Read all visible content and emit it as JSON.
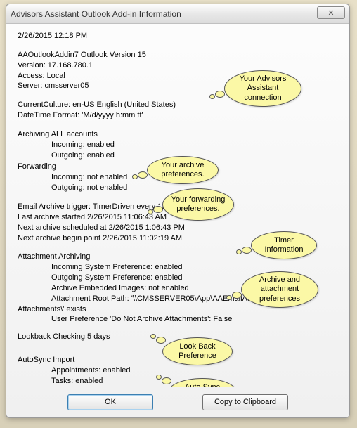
{
  "window": {
    "title": "Advisors Assistant Outlook Add-in Information",
    "close_glyph": "✕"
  },
  "timestamp": "2/26/2015 12:18 PM",
  "connection": {
    "addin_line": "AAOutlookAddin7   Outlook Version 15",
    "version_line": "Version:  17.168.780.1",
    "access_line": "Access:  Local",
    "server_line": "Server:  cmsserver05"
  },
  "locale": {
    "culture_line": "CurrentCulture:       en-US       English (United States)",
    "datetime_line": "DateTime Format:    'M/d/yyyy h:mm tt'"
  },
  "archiving": {
    "header": "Archiving ALL accounts",
    "incoming": "Incoming:  enabled",
    "outgoing": "Outgoing:  enabled"
  },
  "forwarding": {
    "header": "Forwarding",
    "incoming": "Incoming:  not enabled",
    "outgoing": "Outgoing:  not enabled"
  },
  "timer": {
    "trigger": "Email Archive trigger: TimerDriven every 120 minutes",
    "last_started": "Last archive started           2/26/2015 11:06:43 AM",
    "next_scheduled": "Next archive scheduled at    2/26/2015 1:06:43 PM",
    "next_begin": "Next archive begin point       2/26/2015 11:02:19 AM"
  },
  "attachment": {
    "header": "Attachment Archiving",
    "in_pref": "Incoming System Preference:  enabled",
    "out_pref": "Outgoing System Preference:  enabled",
    "embed": "Archive Embedded Images:  not enabled",
    "root": "Attachment Root Path:  '\\\\CMSSERVER05\\App\\AAEmailAttch\\Outlook",
    "tail": "Attachments\\'          exists",
    "user_pref": "User Preference 'Do Not Archive Attachments': False"
  },
  "lookback": {
    "line": "Lookback Checking 5 days"
  },
  "autosync": {
    "header": "AutoSync Import",
    "appts": "Appointments:   enabled",
    "tasks": "Tasks:      enabled"
  },
  "callouts": {
    "c1": "Your Advisors Assistant connection",
    "c2": "Your archive preferences.",
    "c3": "Your forwarding preferences.",
    "c4": "Timer Information",
    "c5": "Archive and attachment preferences",
    "c6": "Look Back Preference",
    "c7": "Auto Sync Preference"
  },
  "buttons": {
    "ok": "OK",
    "copy": "Copy to Clipboard"
  }
}
